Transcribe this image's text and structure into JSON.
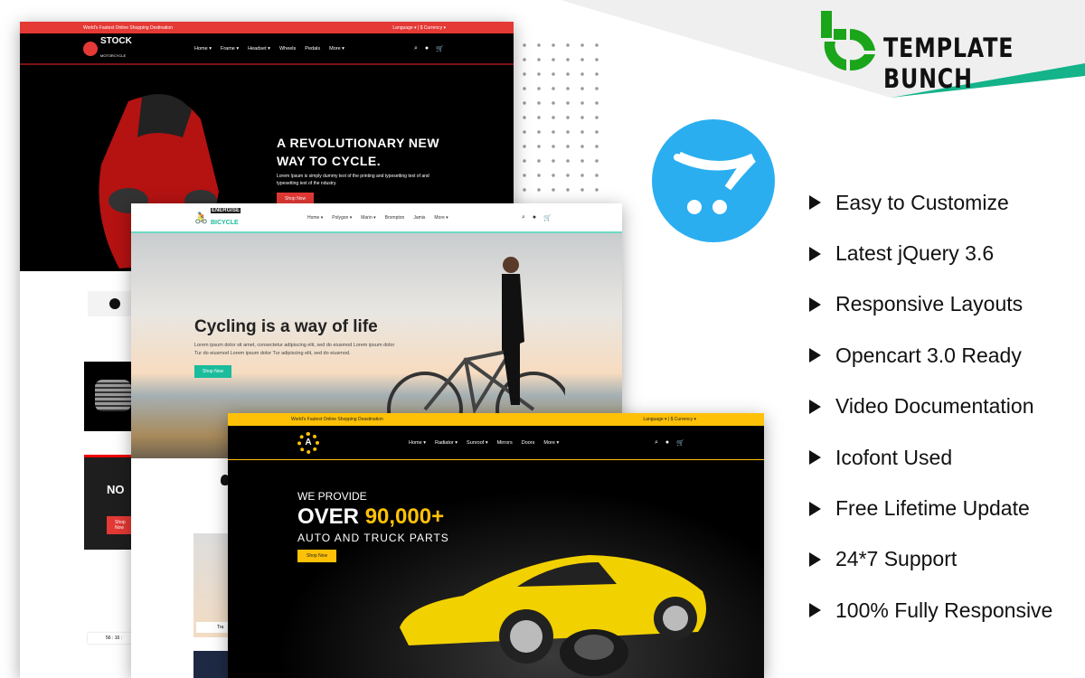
{
  "brand": {
    "name": "TEMPLATE BUNCH",
    "accent": "#1aa51a",
    "stripe": "#14b38a"
  },
  "opencart": {
    "icon": "opencart-cart-icon",
    "color": "#2aaef0"
  },
  "features": [
    "Easy to Customize",
    "Latest jQuery 3.6",
    "Responsive Layouts",
    "Opencart 3.0 Ready",
    "Video Documentation",
    "Icofont Used",
    "Free Lifetime Update",
    "24*7 Support",
    "100% Fully Responsive"
  ],
  "stock": {
    "topbar": {
      "tagline": "World's Fastest Online Shopping Destination",
      "language": "Language",
      "currency": "$ Currency"
    },
    "logo": {
      "title": "STOCK",
      "subtitle": "MOTORCYCLE"
    },
    "menu": [
      "Home ▾",
      "Frame ▾",
      "Headset ▾",
      "Wheels",
      "Pedals",
      "More ▾"
    ],
    "hero": {
      "title1": "A REVOLUTIONARY NEW",
      "title2": "WAY TO CYCLE.",
      "text": "Lorem Ipsum is simply dummy text of the printing and typesetting text of and typesetting text of the ndustry.",
      "button": "Shop Now"
    },
    "banner": {
      "title": "NO",
      "button": "Shop Now"
    },
    "timer": "56 : 16 :",
    "color": "#e53935"
  },
  "bicycle": {
    "logo": {
      "title": "ENERGISE",
      "subtitle": "BICYCLE"
    },
    "menu": [
      "Home ▾",
      "Polygon ▾",
      "Marin ▾",
      "Brompton",
      "Jamis",
      "More ▾"
    ],
    "hero": {
      "title": "Cycling is a way of life",
      "text": "Lorem ipsum dolor sit amet, consectetur adipiscing elit, sed do eiusmod Lorem ipsum dolor Tur do eiusmod Lorem ipsum dolor Tur adipiscing elit, sed do eiusmod.",
      "button": "Shop Now"
    },
    "product": "Tra",
    "color": "#1abc9c"
  },
  "auto": {
    "topbar": {
      "tagline": "World's Fastest Online Shopping Deastination",
      "language": "Language",
      "currency": "$ Currency"
    },
    "logo": {
      "letter": "A"
    },
    "menu": [
      "Home ▾",
      "Radiator ▾",
      "Sunroof ▾",
      "Mirrors",
      "Doors",
      "More ▾"
    ],
    "hero": {
      "pre": "WE PROVIDE",
      "over": "OVER",
      "number": "90,000+",
      "sub": "AUTO AND TRUCK PARTS",
      "button": "Shop Now"
    },
    "color": "#ffc107"
  }
}
